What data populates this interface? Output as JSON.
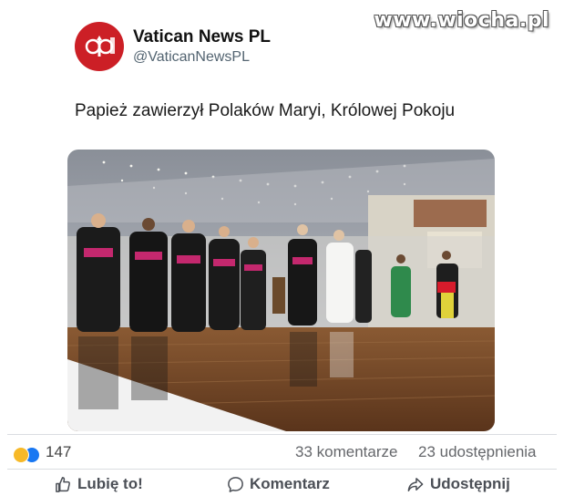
{
  "watermark": "www.wiocha.pl",
  "post": {
    "account_name": "Vatican News PL",
    "account_handle": "@VaticanNewsPL",
    "avatar_icon": "vatican-news-logo-icon",
    "avatar_color": "#cc1f26",
    "text": "Papież zawierzył Polaków Maryi, Królowej Pokoju",
    "photo": "photo-pope-audience-hall"
  },
  "stats": {
    "reaction_icons": [
      "haha-reaction-icon",
      "like-reaction-icon"
    ],
    "reaction_count": "147",
    "comments": "33 komentarze",
    "shares": "23 udostępnienia"
  },
  "actions": {
    "like": "Lubię to!",
    "comment": "Komentarz",
    "share": "Udostępnij"
  }
}
